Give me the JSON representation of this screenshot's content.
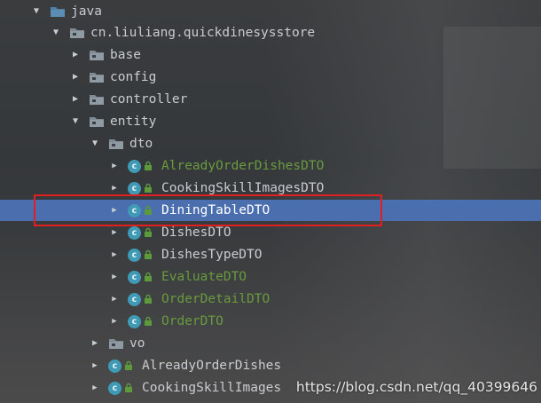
{
  "colors": {
    "selection": "#4b6eaf",
    "text_default": "#c9ccd0",
    "text_vcs_added": "#6a9a3e",
    "class_badge": "#3f9bb5",
    "annotation_box": "#e02020",
    "folder": "#6a7c8a"
  },
  "tree": {
    "items": [
      {
        "label": "java",
        "type": "folder",
        "expanded": true,
        "icon": "source-folder-icon"
      },
      {
        "label": "cn.liuliang.quickdinesysstore",
        "type": "package",
        "expanded": true,
        "icon": "package-icon"
      },
      {
        "label": "base",
        "type": "package",
        "expanded": false,
        "icon": "package-icon"
      },
      {
        "label": "config",
        "type": "package",
        "expanded": false,
        "icon": "package-icon"
      },
      {
        "label": "controller",
        "type": "package",
        "expanded": false,
        "icon": "package-icon"
      },
      {
        "label": "entity",
        "type": "package",
        "expanded": true,
        "icon": "package-icon"
      },
      {
        "label": "dto",
        "type": "package",
        "expanded": true,
        "icon": "package-icon"
      },
      {
        "label": "AlreadyOrderDishesDTO",
        "type": "class",
        "vcs": "added",
        "icon": "class-icon"
      },
      {
        "label": "CookingSkillImagesDTO",
        "type": "class",
        "vcs": "none",
        "icon": "class-icon"
      },
      {
        "label": "DiningTableDTO",
        "type": "class",
        "vcs": "none",
        "selected": true,
        "icon": "class-icon"
      },
      {
        "label": "DishesDTO",
        "type": "class",
        "vcs": "none",
        "icon": "class-icon"
      },
      {
        "label": "DishesTypeDTO",
        "type": "class",
        "vcs": "none",
        "icon": "class-icon"
      },
      {
        "label": "EvaluateDTO",
        "type": "class",
        "vcs": "added",
        "icon": "class-icon"
      },
      {
        "label": "OrderDetailDTO",
        "type": "class",
        "vcs": "added",
        "icon": "class-icon"
      },
      {
        "label": "OrderDTO",
        "type": "class",
        "vcs": "added",
        "icon": "class-icon"
      },
      {
        "label": "vo",
        "type": "package",
        "expanded": false,
        "icon": "package-icon"
      },
      {
        "label": "AlreadyOrderDishes",
        "type": "class",
        "vcs": "none",
        "icon": "class-icon"
      },
      {
        "label": "CookingSkillImages",
        "type": "class",
        "vcs": "none",
        "icon": "class-icon"
      }
    ]
  },
  "watermark": "https://blog.csdn.net/qq_40399646"
}
